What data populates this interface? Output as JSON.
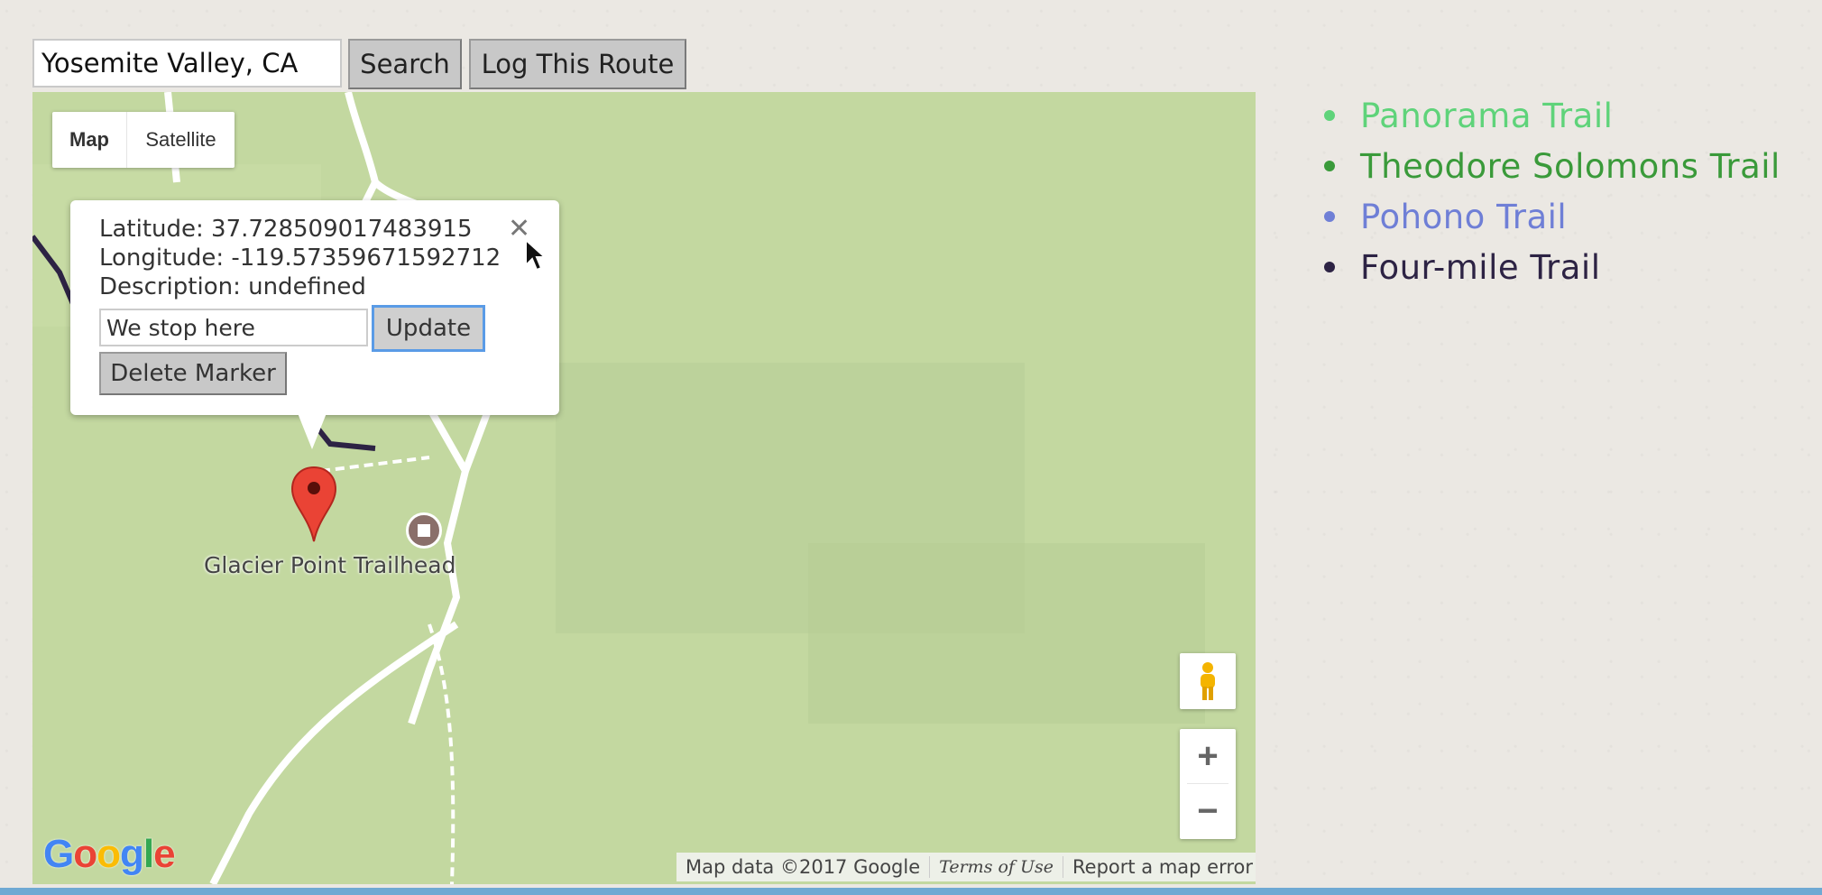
{
  "search": {
    "value": "Yosemite Valley, CA"
  },
  "toolbar": {
    "search_label": "Search",
    "log_label": "Log This Route"
  },
  "map": {
    "type_controls": {
      "map": "Map",
      "satellite": "Satellite"
    },
    "infowindow": {
      "latitude": "Latitude: 37.728509017483915",
      "longitude": "Longitude: -119.57359671592712",
      "description": "Description: undefined",
      "input_value": "We stop here",
      "update_label": "Update",
      "delete_label": "Delete Marker",
      "close_icon": "close-icon"
    },
    "poi_label": "Glacier Point Trailhead",
    "zoom_in": "+",
    "zoom_out": "−",
    "logo": {
      "letters": [
        "G",
        "o",
        "o",
        "g",
        "l",
        "e"
      ],
      "colors": [
        "#4285f4",
        "#ea4335",
        "#fbbc05",
        "#4285f4",
        "#34a853",
        "#ea4335"
      ]
    },
    "attribution": {
      "map_data": "Map data ©2017 Google",
      "terms": "Terms of Use",
      "report": "Report a map error"
    }
  },
  "trails": [
    {
      "name": "Panorama Trail",
      "color": "#5fd37a"
    },
    {
      "name": "Theodore Solomons Trail",
      "color": "#3a9a3a"
    },
    {
      "name": "Pohono Trail",
      "color": "#6f7fd6"
    },
    {
      "name": "Four-mile Trail",
      "color": "#2d2344"
    }
  ]
}
